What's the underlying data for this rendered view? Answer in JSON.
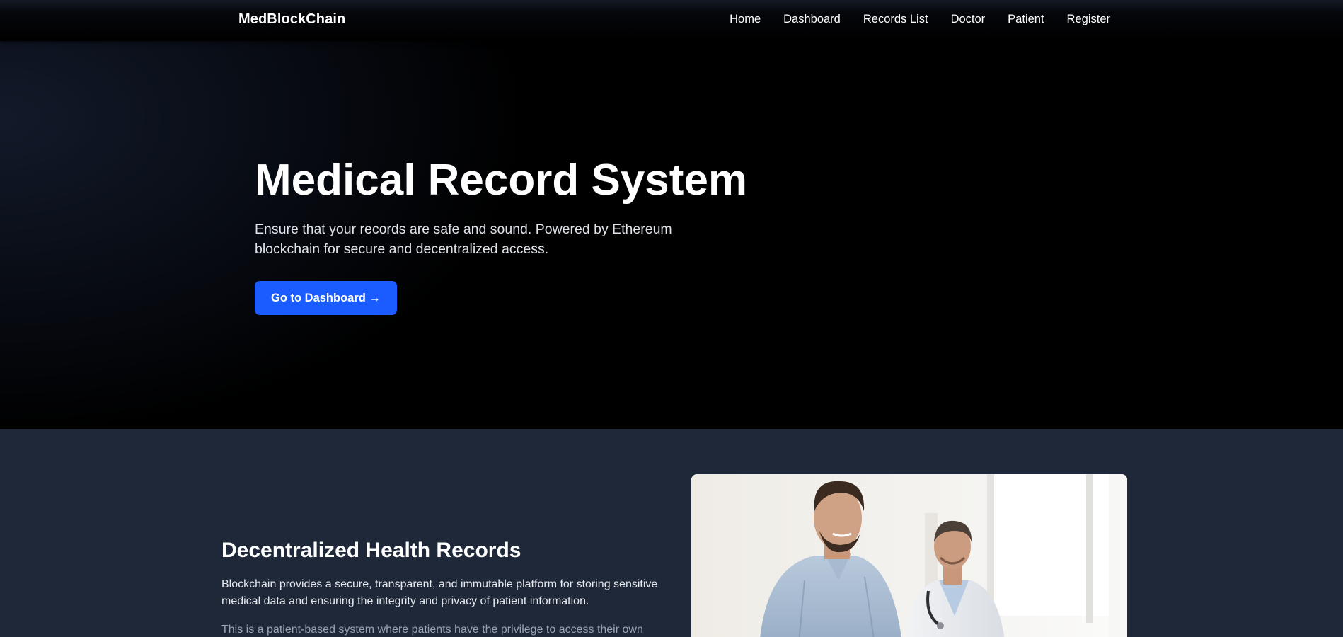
{
  "navbar": {
    "brand": "MedBlockChain",
    "links": [
      "Home",
      "Dashboard",
      "Records List",
      "Doctor",
      "Patient",
      "Register"
    ]
  },
  "hero": {
    "title": "Medical Record System",
    "subtitle": "Ensure that your records are safe and sound. Powered by Ethereum blockchain for secure and decentralized access.",
    "button_label": "Go to Dashboard →"
  },
  "about": {
    "title": "Decentralized Health Records",
    "paragraph1": "Blockchain provides a secure, transparent, and immutable platform for storing sensitive medical data and ensuring the integrity and privacy of patient information.",
    "paragraph2": "This is a patient-based system where patients have the privilege to access their own",
    "image": "patient-and-doctor-photo"
  },
  "colors": {
    "accent": "#1a5cff",
    "hero_bg": "#000000",
    "section_bg": "#1f2838"
  }
}
